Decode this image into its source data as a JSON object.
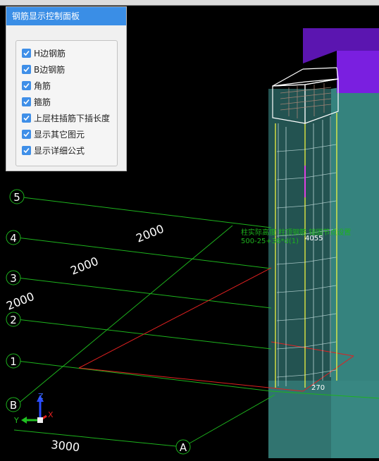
{
  "panel": {
    "title": "钢筋显示控制面板",
    "options": [
      {
        "label": "H边钢筋",
        "checked": true
      },
      {
        "label": "B边钢筋",
        "checked": true
      },
      {
        "label": "角筋",
        "checked": true
      },
      {
        "label": "箍筋",
        "checked": true
      },
      {
        "label": "上层柱插筋下插长度",
        "checked": true
      },
      {
        "label": "显示其它图元",
        "checked": true
      },
      {
        "label": "显示详细公式",
        "checked": true
      }
    ]
  },
  "scene": {
    "grid_axes": [
      "5",
      "4",
      "3",
      "2",
      "1",
      "B",
      "A"
    ],
    "dimensions": {
      "row_spacing_1": "2000",
      "row_spacing_2": "2000",
      "row_spacing_3": "2000",
      "col_spacing": "3000"
    },
    "annotation": {
      "line1": "柱实际高度 柱顶钢筋 锚固节点设置",
      "line2": "500-25+36*d(1)",
      "value": "4055"
    },
    "dim_label": "270",
    "triad": {
      "x": "X",
      "y": "Y",
      "z": "Z"
    },
    "colors": {
      "grid": "#1db31d",
      "axis_line": "#e02020",
      "column_box": "#3c8a85",
      "beam": "#7a1fe0",
      "rebar": "#ffff40",
      "annotation": "#1db31d"
    }
  }
}
